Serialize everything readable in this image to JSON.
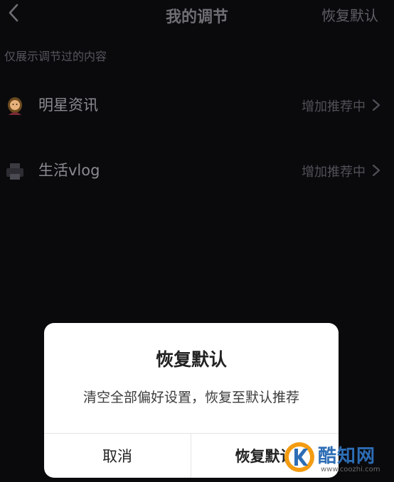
{
  "header": {
    "title": "我的调节",
    "restore_label": "恢复默认"
  },
  "caption": "仅展示调节过的内容",
  "rows": [
    {
      "name": "明星资讯",
      "status": "增加推荐中",
      "icon": "celebrity-emoji-icon"
    },
    {
      "name": "生活vlog",
      "status": "增加推荐中",
      "icon": "printer-emoji-icon"
    }
  ],
  "dialog": {
    "title": "恢复默认",
    "message": "清空全部偏好设置，恢复至默认推荐",
    "cancel_label": "取消",
    "confirm_label": "恢复默认"
  },
  "watermark": {
    "name": "酷知网",
    "url": "www.coozhi.com",
    "brand_color": "#2d6db5",
    "accent_color": "#f39c12"
  }
}
